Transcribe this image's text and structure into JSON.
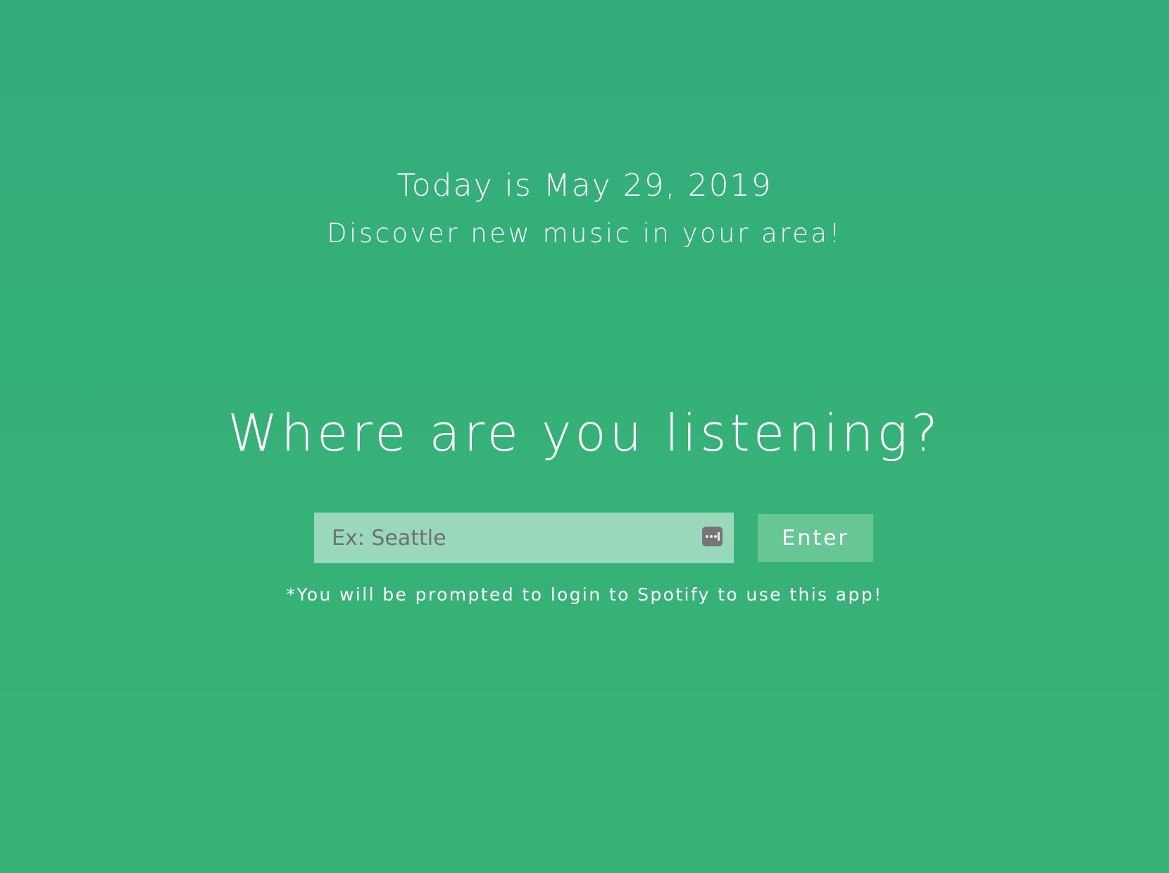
{
  "header": {
    "date_text": "Today is May 29, 2019",
    "tagline": "Discover new music in your area!"
  },
  "main": {
    "question": "Where are you listening?",
    "location_input": {
      "placeholder": "Ex: Seattle",
      "value": ""
    },
    "autofill_icon": "password-manager-icon",
    "enter_button_label": "Enter",
    "login_note": "*You will be prompted to login to Spotify to use this app!"
  },
  "colors": {
    "background": "#34ae79",
    "input_background": "#9ad8bb",
    "button_background": "#67c596",
    "text": "#ffffff",
    "placeholder": "#707070"
  }
}
